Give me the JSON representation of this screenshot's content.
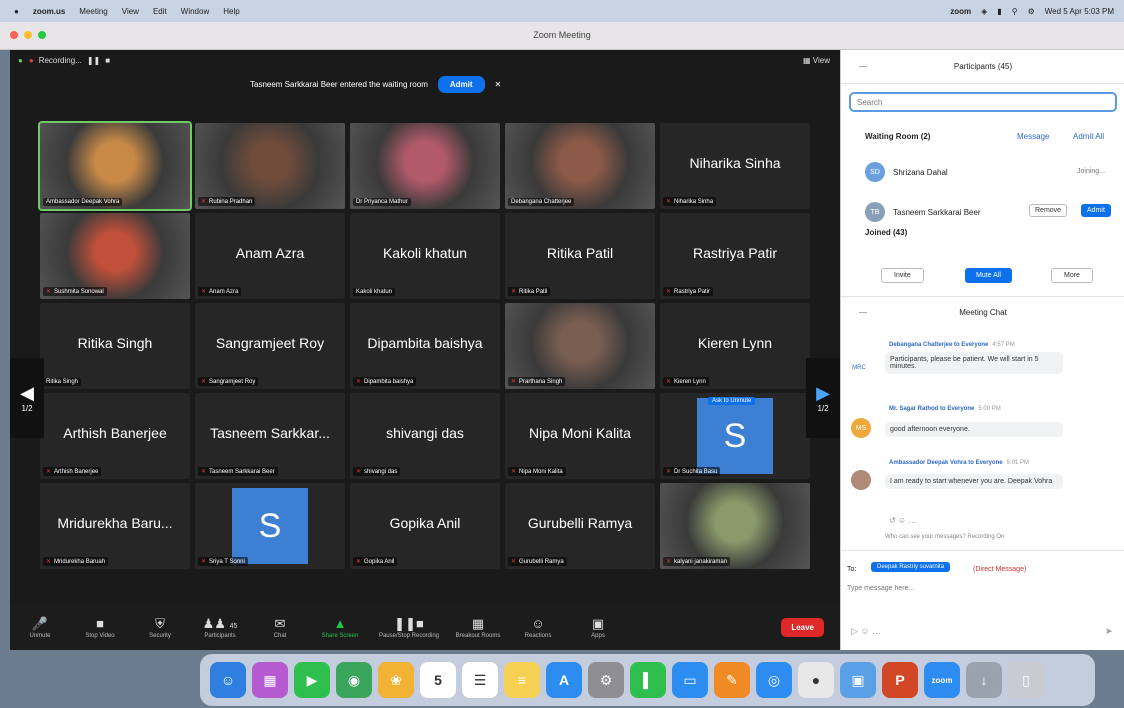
{
  "menubar": {
    "apple": "",
    "app": "zoom.us",
    "items": [
      "Meeting",
      "View",
      "Edit",
      "Window",
      "Help"
    ],
    "zoom_label": "zoom",
    "clock": "Wed 5 Apr 5:03 PM"
  },
  "window": {
    "title": "Zoom Meeting"
  },
  "stage": {
    "recording": "Recording...",
    "view_label": "View"
  },
  "notification": {
    "text": "Tasneem Sarkkarai Beer entered the waiting room",
    "admit": "Admit",
    "close": "✕"
  },
  "tiles": [
    {
      "big": "",
      "name": "Ambassador Deepak Vohra",
      "muted": false
    },
    {
      "big": "",
      "name": "Rubina Pradhan",
      "muted": true
    },
    {
      "big": "",
      "name": "Dr Priyanca Mathur",
      "muted": false
    },
    {
      "big": "",
      "name": "Debangana Chatterjee",
      "muted": false
    },
    {
      "big": "Niharika Sinha",
      "name": "Niharika Sinha",
      "muted": true
    },
    {
      "big": "",
      "name": "Sushmita Sonowal",
      "muted": true
    },
    {
      "big": "Anam Azra",
      "name": "Anam Azra",
      "muted": true
    },
    {
      "big": "Kakoli khatun",
      "name": "Kakoli khatun",
      "muted": false
    },
    {
      "big": "Ritika Patil",
      "name": "Ritika Patil",
      "muted": true
    },
    {
      "big": "Rastriya Patir",
      "name": "Rastriya Patir",
      "muted": true
    },
    {
      "big": "Ritika Singh",
      "name": "Ritika Singh",
      "muted": false
    },
    {
      "big": "Sangramjeet Roy",
      "name": "Sangramjeet Roy",
      "muted": true
    },
    {
      "big": "Dipambita baishya",
      "name": "Dipambita baishya",
      "muted": true
    },
    {
      "big": "",
      "name": "Prarthana Singh",
      "muted": true
    },
    {
      "big": "Kieren Lynn",
      "name": "Kieren Lynn",
      "muted": true
    },
    {
      "big": "Arthish Banerjee",
      "name": "Arthish Banerjee",
      "muted": true
    },
    {
      "big": "Tasneem Sarkkar...",
      "name": "Tasneem Sarkkarai Beer",
      "muted": true
    },
    {
      "big": "shivangi das",
      "name": "shivangi das",
      "muted": true
    },
    {
      "big": "Nipa Moni Kalita",
      "name": "Nipa Moni Kalita",
      "muted": true
    },
    {
      "big": "",
      "name": "Dr Suchita Basu",
      "muted": true
    },
    {
      "big": "Mridurekha Baru...",
      "name": "Mridurekha Baruah",
      "muted": true
    },
    {
      "big": "",
      "name": "Sriya T Sonni",
      "muted": true
    },
    {
      "big": "Gopika Anil",
      "name": "Gopika Anil",
      "muted": true
    },
    {
      "big": "Gurubelli Ramya",
      "name": "Gurubelli Ramya",
      "muted": true
    },
    {
      "big": "",
      "name": "kalyani janakiraman",
      "muted": true
    }
  ],
  "avatar_s": "S",
  "ask_unmute": "Ask to Unmute",
  "pager": {
    "left": "1/2",
    "right": "1/2"
  },
  "toolbar": {
    "buttons": [
      "Unmute",
      "Stop Video",
      "Security",
      "Participants",
      "Chat",
      "Share Screen",
      "Pause/Stop Recording",
      "Breakout Rooms",
      "Reactions",
      "Apps"
    ],
    "participants_count": "45",
    "leave": "Leave"
  },
  "panel": {
    "title": "Participants (45)",
    "search_placeholder": "Search",
    "waiting_room": "Waiting Room (2)",
    "message": "Message",
    "admit_all": "Admit All",
    "waiting": [
      {
        "initials": "SD",
        "name": "Shrizana Dahal",
        "status": "Joining..."
      },
      {
        "initials": "TB",
        "name": "Tasneem Sarkkarai Beer",
        "remove": "Remove",
        "admit": "Admit"
      }
    ],
    "joined": "Joined (43)",
    "invite": "Invite",
    "mute_all": "Mute All",
    "more": "More",
    "chat_title": "Meeting Chat",
    "chat": [
      {
        "sender": "Debangana Chatterjee to Everyone",
        "time": "4:57 PM",
        "initials": "MRC",
        "text": "Participants, please be patient. We will start in 5 minutes."
      },
      {
        "sender": "Mr. Sagar Rathod to Everyone",
        "time": "5:00 PM",
        "initials": "MS",
        "text": "good afternoon everyone."
      },
      {
        "sender": "Ambassador Deepak Vohra to Everyone",
        "time": "5:01 PM",
        "initials": "",
        "text": "I am ready to start whenever you are. Deepak Vohra"
      }
    ],
    "who_can_see": "Who can see your messages? Recording On",
    "to": "To:",
    "to_target": "Deepak Rastriy suvarnita",
    "direct": "(Direct Message)",
    "input_placeholder": "Type message here..."
  },
  "dock": [
    "Finder",
    "Launchpad",
    "FaceTime",
    "Maps",
    "Photos",
    "Calendar",
    "Reminders",
    "Notes",
    "App Store",
    "System Preferences",
    "Numbers",
    "Keynote",
    "Pages",
    "Safari",
    "Chrome",
    "Preview",
    "PowerPoint",
    "Zoom",
    "Downloads",
    "Trash"
  ],
  "calendar_day": "5"
}
